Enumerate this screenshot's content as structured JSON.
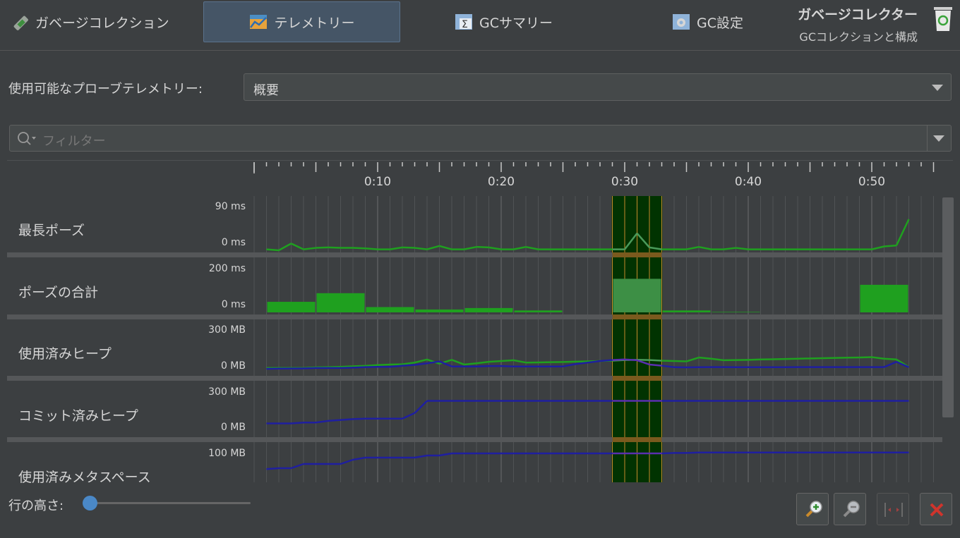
{
  "tabs": [
    {
      "label": "ガベージコレクション",
      "icon": "garbage-collection-icon"
    },
    {
      "label": "テレメトリー",
      "icon": "telemetry-icon",
      "active": true
    },
    {
      "label": "GCサマリー",
      "icon": "gc-summary-icon"
    },
    {
      "label": "GC設定",
      "icon": "gc-settings-icon"
    }
  ],
  "header": {
    "title": "ガベージコレクター",
    "subtitle": "GCコレクションと構成",
    "icon": "recycle-bin-icon"
  },
  "probe": {
    "label": "使用可能なプローブテレメトリー:",
    "selected": "概要"
  },
  "filter": {
    "placeholder": "フィルター"
  },
  "timeline": {
    "ticks": [
      "0:10",
      "0:20",
      "0:30",
      "0:40",
      "0:50"
    ]
  },
  "rows": [
    {
      "label": "最長ポーズ",
      "max": "90 ms",
      "min": "0 ms"
    },
    {
      "label": "ポーズの合計",
      "max": "200 ms",
      "min": "0 ms"
    },
    {
      "label": "使用済みヒープ",
      "max": "300 MB",
      "min": "0 MB"
    },
    {
      "label": "コミット済みヒープ",
      "max": "300 MB",
      "min": "0 MB"
    },
    {
      "label": "使用済みメタスペース",
      "max": "100 MB",
      "min": ""
    }
  ],
  "row_height": {
    "label": "行の高さ:",
    "value": 0
  },
  "colors": {
    "green": "#1fa01f",
    "blue": "#1f1fa0",
    "selection": "#013301",
    "accent": "#4a88c7"
  },
  "chart_data": {
    "type": "line",
    "x_unit": "seconds",
    "xlim": [
      0,
      55
    ],
    "selection": [
      29,
      33
    ],
    "series": [
      {
        "row": 0,
        "kind": "line",
        "color": "#1fa01f",
        "x": [
          1,
          2,
          3,
          4,
          5,
          6,
          7,
          8,
          9,
          10,
          11,
          12,
          13,
          14,
          15,
          16,
          17,
          18,
          19,
          20,
          21,
          22,
          23,
          24,
          25,
          26,
          27,
          28,
          29,
          30,
          31,
          32,
          33,
          34,
          35,
          36,
          37,
          38,
          39,
          40,
          41,
          42,
          43,
          44,
          45,
          46,
          47,
          48,
          49,
          50,
          51,
          52,
          53
        ],
        "y": [
          2,
          0,
          14,
          2,
          5,
          6,
          5,
          5,
          4,
          2,
          2,
          6,
          5,
          2,
          9,
          2,
          2,
          7,
          6,
          2,
          2,
          7,
          2,
          2,
          2,
          2,
          2,
          2,
          2,
          2,
          35,
          6,
          2,
          2,
          2,
          7,
          2,
          2,
          5,
          2,
          2,
          2,
          2,
          2,
          2,
          2,
          2,
          2,
          2,
          2,
          8,
          10,
          64
        ]
      },
      {
        "row": 1,
        "kind": "bar",
        "color": "#1fa01f",
        "bars": [
          [
            1,
            5,
            44
          ],
          [
            5,
            9,
            80
          ],
          [
            9,
            13,
            22
          ],
          [
            13,
            17,
            12
          ],
          [
            17,
            21,
            18
          ],
          [
            21,
            25,
            8
          ],
          [
            29,
            33,
            140
          ],
          [
            33,
            37,
            8
          ],
          [
            37,
            41,
            2
          ],
          [
            49,
            53,
            115
          ]
        ]
      },
      {
        "row": 2,
        "kind": "line",
        "color": "#1fa01f",
        "x": [
          1,
          2,
          3,
          4,
          5,
          6,
          7,
          8,
          9,
          10,
          11,
          12,
          13,
          14,
          15,
          16,
          17,
          18,
          19,
          20,
          21,
          22,
          23,
          24,
          25,
          26,
          27,
          28,
          29,
          30,
          31,
          32,
          33,
          34,
          35,
          36,
          37,
          38,
          39,
          40,
          41,
          42,
          43,
          44,
          45,
          46,
          47,
          48,
          49,
          50,
          51,
          52,
          53
        ],
        "y": [
          10,
          10,
          10,
          10,
          18,
          20,
          25,
          32,
          38,
          48,
          55,
          58,
          80,
          120,
          65,
          115,
          55,
          70,
          90,
          100,
          110,
          80,
          82,
          85,
          88,
          92,
          96,
          100,
          105,
          112,
          116,
          112,
          105,
          100,
          95,
          145,
          130,
          110,
          113,
          115,
          120,
          123,
          126,
          130,
          133,
          136,
          140,
          143,
          146,
          150,
          130,
          120,
          22
        ]
      },
      {
        "row": 2,
        "kind": "line",
        "color": "#1f1fa0",
        "x": [
          1,
          2,
          3,
          4,
          5,
          6,
          7,
          8,
          9,
          10,
          11,
          12,
          13,
          14,
          15,
          16,
          17,
          18,
          19,
          20,
          21,
          22,
          23,
          24,
          25,
          26,
          27,
          28,
          29,
          30,
          31,
          32,
          33,
          34,
          35,
          36,
          37,
          38,
          39,
          40,
          41,
          42,
          43,
          44,
          45,
          46,
          47,
          48,
          49,
          50,
          51,
          52,
          53
        ],
        "y": [
          0,
          2,
          3,
          4,
          10,
          10,
          10,
          15,
          22,
          25,
          25,
          40,
          50,
          70,
          95,
          30,
          30,
          30,
          35,
          35,
          30,
          30,
          30,
          30,
          30,
          60,
          80,
          100,
          113,
          120,
          110,
          55,
          40,
          20,
          18,
          20,
          22,
          22,
          20,
          20,
          20,
          20,
          20,
          22,
          22,
          22,
          22,
          22,
          22,
          22,
          22,
          90,
          20
        ]
      },
      {
        "row": 3,
        "kind": "line",
        "color": "#1f1fa0",
        "x": [
          1,
          2,
          3,
          4,
          5,
          6,
          7,
          8,
          9,
          10,
          11,
          12,
          13,
          14,
          15,
          16,
          17,
          18,
          19,
          20,
          21,
          22,
          23,
          24,
          25,
          26,
          27,
          28,
          29,
          30,
          31,
          32,
          33,
          34,
          35,
          36,
          37,
          38,
          39,
          40,
          41,
          42,
          43,
          44,
          45,
          46,
          47,
          48,
          49,
          50,
          51,
          52,
          53
        ],
        "y": [
          20,
          20,
          20,
          30,
          30,
          50,
          60,
          70,
          75,
          75,
          75,
          75,
          140,
          280,
          280,
          280,
          280,
          280,
          280,
          280,
          280,
          280,
          280,
          280,
          280,
          280,
          280,
          280,
          280,
          280,
          280,
          280,
          280,
          280,
          280,
          280,
          280,
          280,
          280,
          280,
          280,
          280,
          280,
          280,
          280,
          280,
          280,
          280,
          280,
          280,
          280,
          280,
          280
        ]
      },
      {
        "row": 4,
        "kind": "line",
        "color": "#1f1fa0",
        "x": [
          1,
          2,
          3,
          4,
          5,
          6,
          7,
          8,
          9,
          10,
          11,
          12,
          13,
          14,
          15,
          16,
          17,
          18,
          19,
          20,
          21,
          22,
          23,
          24,
          25,
          26,
          27,
          28,
          29,
          30,
          31,
          32,
          33,
          34,
          35,
          36,
          37,
          38,
          39,
          40,
          41,
          42,
          43,
          44,
          45,
          46,
          47,
          48,
          49,
          50,
          51,
          52,
          53
        ],
        "y": [
          58,
          60,
          60,
          70,
          70,
          70,
          70,
          80,
          85,
          85,
          85,
          85,
          85,
          90,
          90,
          95,
          95,
          95,
          95,
          95,
          95,
          95,
          95,
          95,
          95,
          95,
          95,
          95,
          95,
          95,
          95,
          95,
          95,
          96,
          96,
          97,
          97,
          97,
          97,
          97,
          97,
          97,
          97,
          97,
          97,
          97,
          97,
          97,
          97,
          97,
          97,
          97,
          97
        ]
      }
    ]
  }
}
